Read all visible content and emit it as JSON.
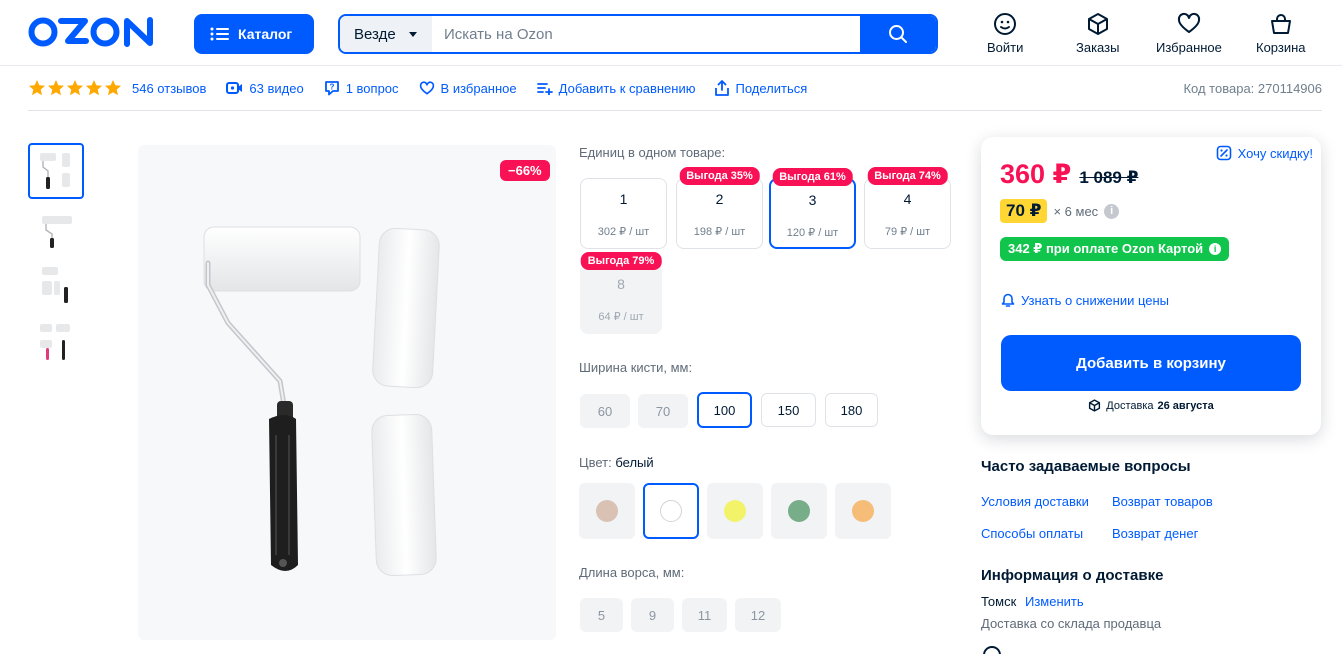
{
  "header": {
    "logo": "OZON",
    "catalog_label": "Каталог",
    "search_scope": "Везде",
    "search_placeholder": "Искать на Ozon",
    "nav": [
      {
        "label": "Войти",
        "icon": "face-icon"
      },
      {
        "label": "Заказы",
        "icon": "box-icon"
      },
      {
        "label": "Избранное",
        "icon": "heart-icon"
      },
      {
        "label": "Корзина",
        "icon": "cart-icon"
      }
    ]
  },
  "subbar": {
    "rating_stars": 5,
    "reviews": "546 отзывов",
    "videos": "63 видео",
    "questions": "1 вопрос",
    "favorite": "В избранное",
    "compare": "Добавить к сравнению",
    "share": "Поделиться",
    "sku": "Код товара: 270114906"
  },
  "gallery": {
    "discount": "−66%",
    "thumb_count": 4
  },
  "options": {
    "units_label": "Единиц в одном товаре:",
    "units": [
      {
        "n": "1",
        "price": "302 ₽ / шт",
        "badge": null,
        "state": "normal"
      },
      {
        "n": "2",
        "price": "198 ₽ / шт",
        "badge": "Выгода 35%",
        "state": "normal"
      },
      {
        "n": "3",
        "price": "120 ₽ / шт",
        "badge": "Выгода 61%",
        "state": "selected"
      },
      {
        "n": "4",
        "price": "79 ₽ / шт",
        "badge": "Выгода 74%",
        "state": "normal"
      },
      {
        "n": "8",
        "price": "64 ₽ / шт",
        "badge": "Выгода 79%",
        "state": "disabled"
      }
    ],
    "width_label": "Ширина кисти, мм:",
    "widths": [
      {
        "v": "60",
        "state": "disabled"
      },
      {
        "v": "70",
        "state": "disabled"
      },
      {
        "v": "100",
        "state": "selected"
      },
      {
        "v": "150",
        "state": "normal"
      },
      {
        "v": "180",
        "state": "normal"
      }
    ],
    "color_label": "Цвет:",
    "color_value": "белый",
    "colors": [
      {
        "hex": "#d9c1b3",
        "state": "disabled"
      },
      {
        "hex": "#ffffff",
        "state": "selected"
      },
      {
        "hex": "#f3f36a",
        "state": "disabled"
      },
      {
        "hex": "#78ad89",
        "state": "disabled"
      },
      {
        "hex": "#f5bd78",
        "state": "disabled"
      }
    ],
    "pile_label": "Длина ворса, мм:",
    "piles": [
      "5",
      "9",
      "11",
      "12"
    ]
  },
  "card": {
    "want_discount": "Хочу скидку!",
    "price": "360 ₽",
    "old_price": "1 089 ₽",
    "installment": "70 ₽",
    "installment_term": "× 6 мес",
    "ozon_card": "342 ₽ при оплате Ozon Картой",
    "notify": "Узнать о снижении цены",
    "add_to_cart": "Добавить в корзину",
    "delivery_prefix": "Доставка",
    "delivery_date": "26 августа"
  },
  "faq": {
    "title": "Часто задаваемые вопросы",
    "links": [
      "Условия доставки",
      "Возврат товаров",
      "Способы оплаты",
      "Возврат денег"
    ]
  },
  "delivery_info": {
    "title": "Информация о доставке",
    "city": "Томск",
    "change": "Изменить",
    "from": "Доставка со склада продавца"
  },
  "colors": {
    "accent": "#005bff",
    "sale": "#f91155",
    "ozon_card": "#10c44c",
    "installment": "#ffd634"
  }
}
